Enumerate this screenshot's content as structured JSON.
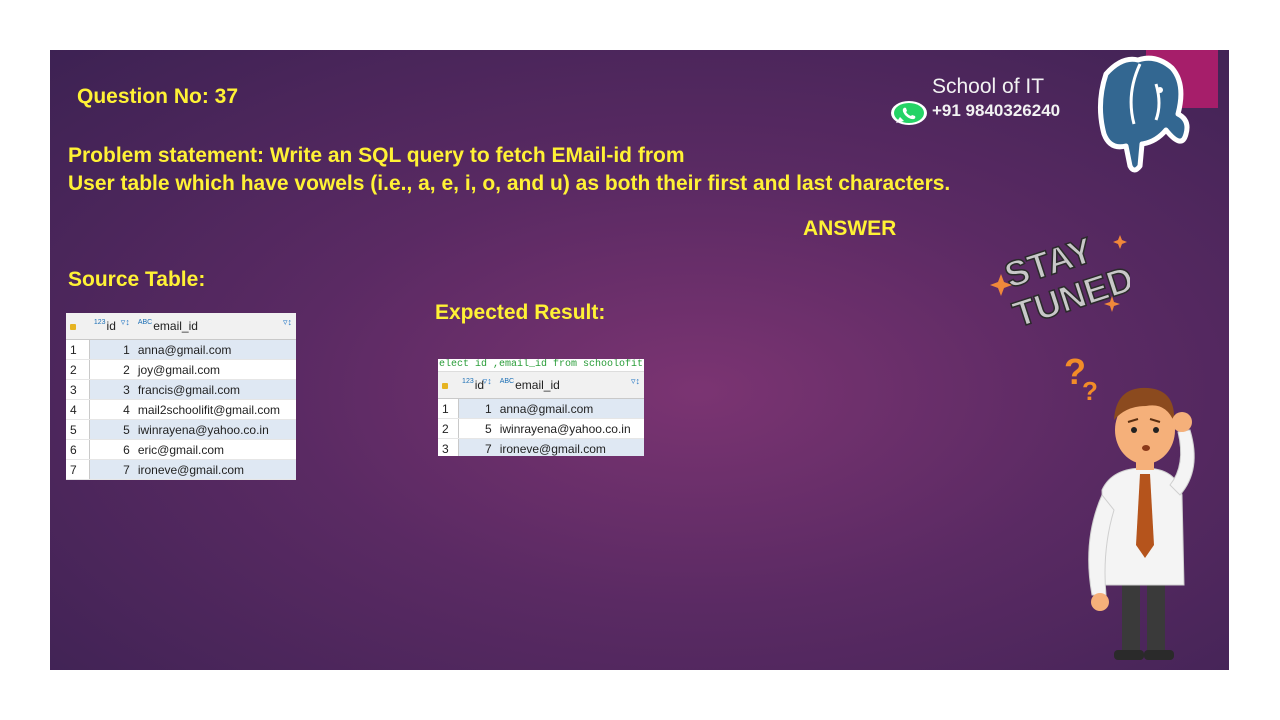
{
  "question": "Question No: 37",
  "problem": {
    "line1": "Problem statement: Write an SQL query to fetch EMail-id from",
    "line2": "User table which have vowels (i.e., a, e, i, o, and u) as both their first and last characters."
  },
  "answer_label": "ANSWER",
  "brand": {
    "name": "School of IT",
    "phone": "+91 9840326240",
    "whatsapp_icon": "whatsapp-icon",
    "logo_icon": "postgresql-elephant-icon"
  },
  "stay_tuned": "STAY TUNED",
  "source": {
    "title": "Source Table:",
    "columns": [
      {
        "type": "123",
        "name": "id"
      },
      {
        "type": "ABC",
        "name": "email_id"
      }
    ],
    "rows": [
      {
        "n": "1",
        "id": "1",
        "email": "anna@gmail.com"
      },
      {
        "n": "2",
        "id": "2",
        "email": "joy@gmail.com"
      },
      {
        "n": "3",
        "id": "3",
        "email": "francis@gmail.com"
      },
      {
        "n": "4",
        "id": "4",
        "email": "mail2schoolifit@gmail.com"
      },
      {
        "n": "5",
        "id": "5",
        "email": "iwinrayena@yahoo.co.in"
      },
      {
        "n": "6",
        "id": "6",
        "email": "eric@gmail.com"
      },
      {
        "n": "7",
        "id": "7",
        "email": "ironeve@gmail.com"
      }
    ]
  },
  "result": {
    "title": "Expected Result:",
    "sql_snippet": "elect id ,email_id from schoolofit.en",
    "columns": [
      {
        "type": "123",
        "name": "id"
      },
      {
        "type": "ABC",
        "name": "email_id"
      }
    ],
    "rows": [
      {
        "n": "1",
        "id": "1",
        "email": "anna@gmail.com"
      },
      {
        "n": "2",
        "id": "5",
        "email": "iwinrayena@yahoo.co.in"
      },
      {
        "n": "3",
        "id": "7",
        "email": "ironeve@gmail.com"
      }
    ]
  },
  "colors": {
    "title_yellow": "#fff235",
    "accent_magenta": "#a61e6a",
    "background_purple": "#5a2a63"
  }
}
